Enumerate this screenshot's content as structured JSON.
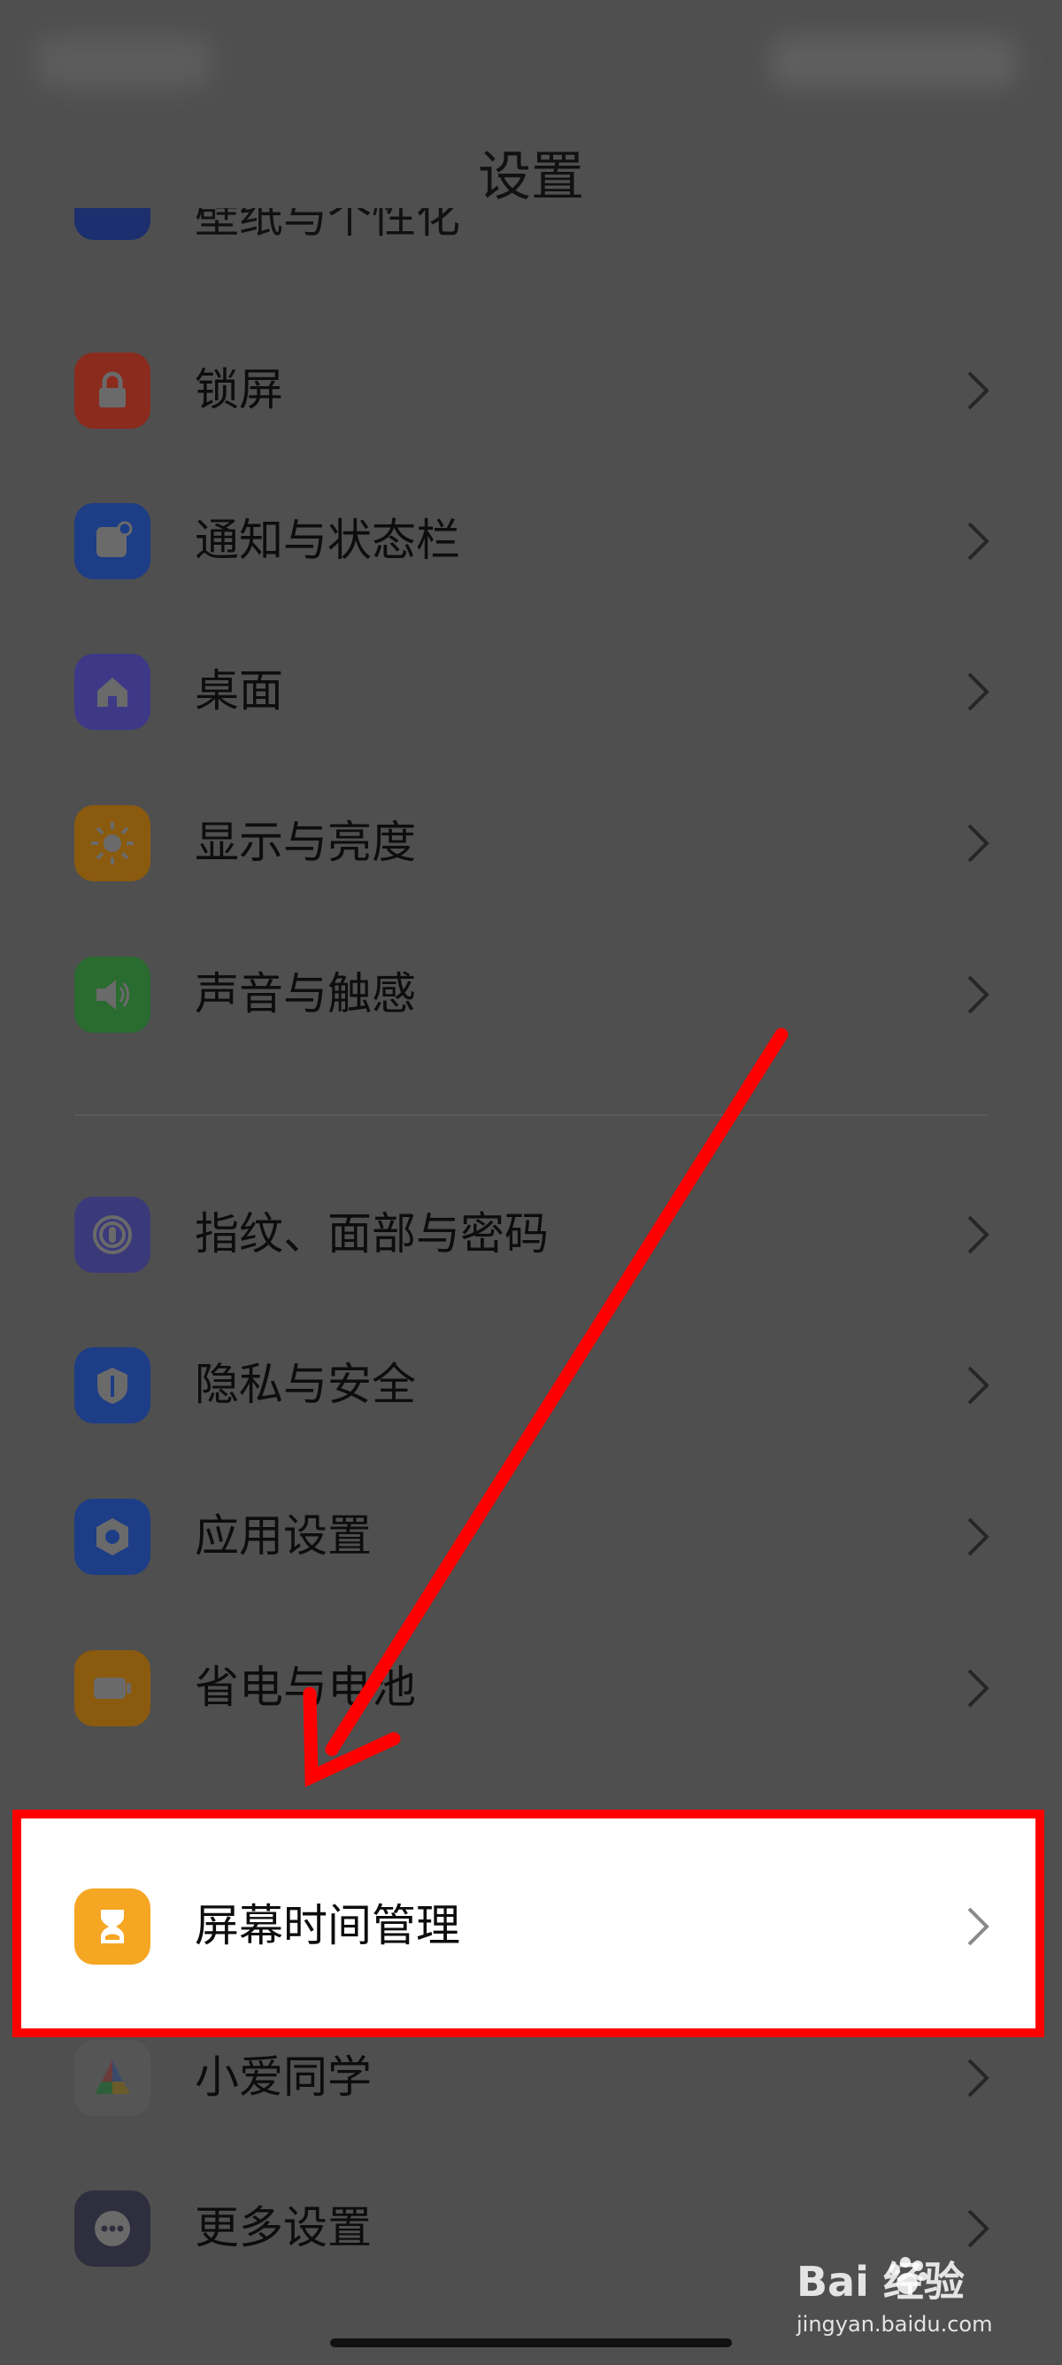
{
  "header": {
    "title": "设置"
  },
  "partial_item": {
    "label": "壁纸与个性化"
  },
  "items": [
    {
      "label": "锁屏",
      "icon": "lock-icon",
      "color": "#8a2b1d"
    },
    {
      "label": "通知与状态栏",
      "icon": "notification-icon",
      "color": "#1d3d86"
    },
    {
      "label": "桌面",
      "icon": "home-icon",
      "color": "#3d3987"
    },
    {
      "label": "显示与亮度",
      "icon": "sun-icon",
      "color": "#8a5a0f"
    },
    {
      "label": "声音与触感",
      "icon": "speaker-icon",
      "color": "#2a6b30"
    },
    {
      "label": "指纹、面部与密码",
      "icon": "fingerprint-icon",
      "color": "#3a3a7a"
    },
    {
      "label": "隐私与安全",
      "icon": "shield-icon",
      "color": "#1d3d86"
    },
    {
      "label": "应用设置",
      "icon": "hexagon-gear-icon",
      "color": "#1d3d86"
    },
    {
      "label": "省电与电池",
      "icon": "battery-icon",
      "color": "#8a5a0f"
    },
    {
      "label": "屏幕时间管理",
      "icon": "hourglass-icon",
      "color": "#f5a623"
    },
    {
      "label": "小爱同学",
      "icon": "xiaoai-icon",
      "color": "#6a6a6a"
    },
    {
      "label": "更多设置",
      "icon": "more-dots-icon",
      "color": "#2e2e3e"
    }
  ],
  "watermark": {
    "main": "Bai  经验",
    "sub": "jingyan.baidu.com"
  },
  "annotation": {
    "arrow_color": "#ff0000",
    "highlight_color": "#ff0000"
  }
}
